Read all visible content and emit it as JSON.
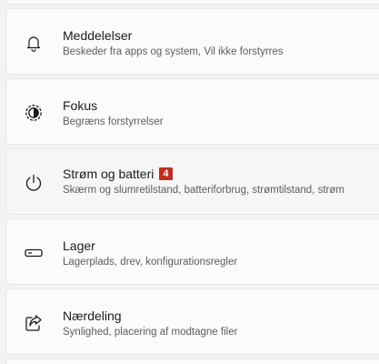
{
  "settings_list": {
    "items": [
      {
        "id": "meddelelser",
        "icon": "bell-icon",
        "title": "Meddelelser",
        "description": "Beskeder fra apps og system, Vil ikke forstyrres"
      },
      {
        "id": "fokus",
        "icon": "focus-icon",
        "title": "Fokus",
        "description": "Begræns forstyrrelser"
      },
      {
        "id": "strom",
        "icon": "power-icon",
        "title": "Strøm og batteri",
        "badge": "4",
        "description": "Skærm og slumretilstand, batteriforbrug, strømtilstand, strøm"
      },
      {
        "id": "lager",
        "icon": "storage-drive-icon",
        "title": "Lager",
        "description": "Lagerplads, drev, konfigurationsregler"
      },
      {
        "id": "naerdeling",
        "icon": "share-icon",
        "title": "Nærdeling",
        "description": "Synlighed, placering af modtagne filer"
      }
    ]
  },
  "colors": {
    "background": "#f3f3f3",
    "card": "#fbfbfb",
    "badge": "#c42b1c"
  }
}
